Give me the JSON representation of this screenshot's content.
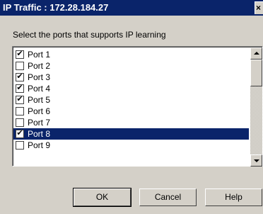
{
  "window": {
    "title": "IP Traffic : 172.28.184.27",
    "close_glyph": "×"
  },
  "instruction": "Select the ports that supports IP learning",
  "ports": [
    {
      "label": "Port 1",
      "checked": true,
      "selected": false
    },
    {
      "label": "Port 2",
      "checked": false,
      "selected": false
    },
    {
      "label": "Port 3",
      "checked": true,
      "selected": false
    },
    {
      "label": "Port 4",
      "checked": true,
      "selected": false
    },
    {
      "label": "Port 5",
      "checked": true,
      "selected": false
    },
    {
      "label": "Port 6",
      "checked": false,
      "selected": false
    },
    {
      "label": "Port 7",
      "checked": false,
      "selected": false
    },
    {
      "label": "Port 8",
      "checked": true,
      "selected": true
    },
    {
      "label": "Port 9",
      "checked": false,
      "selected": false
    }
  ],
  "buttons": {
    "ok": "OK",
    "cancel": "Cancel",
    "help": "Help"
  },
  "colors": {
    "titlebar": "#0a246a",
    "selection": "#0a246a",
    "face": "#d4d0c8"
  },
  "icons": {
    "close": "close-icon",
    "scroll_up": "scroll-up-arrow-icon",
    "scroll_down": "scroll-down-arrow-icon",
    "check": "checkmark-icon"
  }
}
